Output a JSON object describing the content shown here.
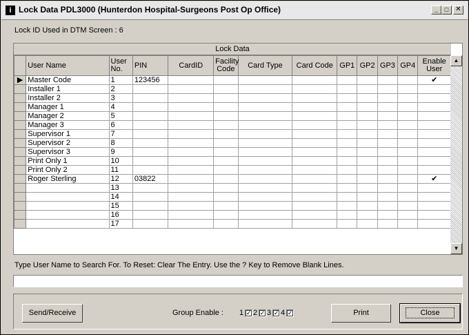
{
  "window": {
    "title": "Lock Data PDL3000 (Hunterdon Hospital-Surgeons Post Op Office)",
    "app_icon": "i",
    "minimize_glyph": "_",
    "maximize_glyph": "□",
    "close_glyph": "✕"
  },
  "lock_id_text": "Lock ID Used in DTM Screen : 6",
  "grid": {
    "caption": "Lock Data",
    "headers": {
      "user_name": "User Name",
      "user_no": "User No.",
      "pin": "PIN",
      "card_id": "CardID",
      "facility_code": "Facility Code",
      "card_type": "Card Type",
      "card_code": "Card Code",
      "gp1": "GP1",
      "gp2": "GP2",
      "gp3": "GP3",
      "gp4": "GP4",
      "enable_user": "Enable User"
    },
    "rows": [
      {
        "name": "Master Code",
        "no": "1",
        "pin": "123456",
        "enabled": "✔",
        "current": "▶"
      },
      {
        "name": "Installer 1",
        "no": "2",
        "pin": "",
        "enabled": "",
        "current": ""
      },
      {
        "name": "Installer 2",
        "no": "3",
        "pin": "",
        "enabled": "",
        "current": ""
      },
      {
        "name": "Manager 1",
        "no": "4",
        "pin": "",
        "enabled": "",
        "current": ""
      },
      {
        "name": "Manager 2",
        "no": "5",
        "pin": "",
        "enabled": "",
        "current": ""
      },
      {
        "name": "Manager 3",
        "no": "6",
        "pin": "",
        "enabled": "",
        "current": ""
      },
      {
        "name": "Supervisor 1",
        "no": "7",
        "pin": "",
        "enabled": "",
        "current": ""
      },
      {
        "name": "Supervisor 2",
        "no": "8",
        "pin": "",
        "enabled": "",
        "current": ""
      },
      {
        "name": "Supervisor 3",
        "no": "9",
        "pin": "",
        "enabled": "",
        "current": ""
      },
      {
        "name": "Print Only 1",
        "no": "10",
        "pin": "",
        "enabled": "",
        "current": ""
      },
      {
        "name": "Print Only 2",
        "no": "11",
        "pin": "",
        "enabled": "",
        "current": ""
      },
      {
        "name": "Roger Sterling",
        "no": "12",
        "pin": "03822",
        "enabled": "✔",
        "current": ""
      },
      {
        "name": "",
        "no": "13",
        "pin": "",
        "enabled": "",
        "current": ""
      },
      {
        "name": "",
        "no": "14",
        "pin": "",
        "enabled": "",
        "current": ""
      },
      {
        "name": "",
        "no": "15",
        "pin": "",
        "enabled": "",
        "current": ""
      },
      {
        "name": "",
        "no": "16",
        "pin": "",
        "enabled": "",
        "current": ""
      },
      {
        "name": "",
        "no": "17",
        "pin": "",
        "enabled": "",
        "current": ""
      }
    ],
    "scroll_up_glyph": "▲",
    "scroll_down_glyph": "▼"
  },
  "hint_text": "Type User Name to Search For. To Reset: Clear The Entry. Use the ? Key to Remove Blank Lines.",
  "search": {
    "value": ""
  },
  "buttons": {
    "send_receive": "Send/Receive",
    "print": "Print",
    "close": "Close"
  },
  "group_enable": {
    "label": "Group Enable :",
    "groups": [
      {
        "num": "1",
        "checked": "✓"
      },
      {
        "num": "2",
        "checked": "✓"
      },
      {
        "num": "3",
        "checked": "✓"
      },
      {
        "num": "4",
        "checked": "✓"
      }
    ]
  }
}
